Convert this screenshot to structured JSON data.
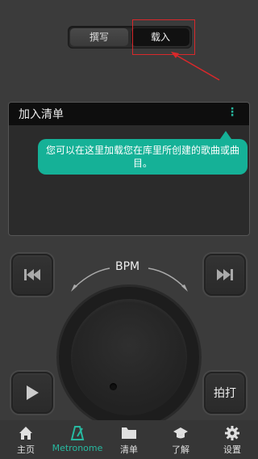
{
  "tabs": {
    "compose": "撰写",
    "load": "载入"
  },
  "panel": {
    "title": "加入清单",
    "more_icon": "⋮"
  },
  "tooltip": {
    "text": "您可以在这里加载您在库里所创建的歌曲或曲目。"
  },
  "controls": {
    "bpm_label": "BPM",
    "tap_label": "拍打"
  },
  "nav": {
    "home": "主页",
    "metronome": "Metronome",
    "list": "清单",
    "learn": "了解",
    "settings": "设置"
  },
  "colors": {
    "accent": "#27b9a0",
    "tooltip": "#15b197",
    "highlight": "#d9282b"
  }
}
